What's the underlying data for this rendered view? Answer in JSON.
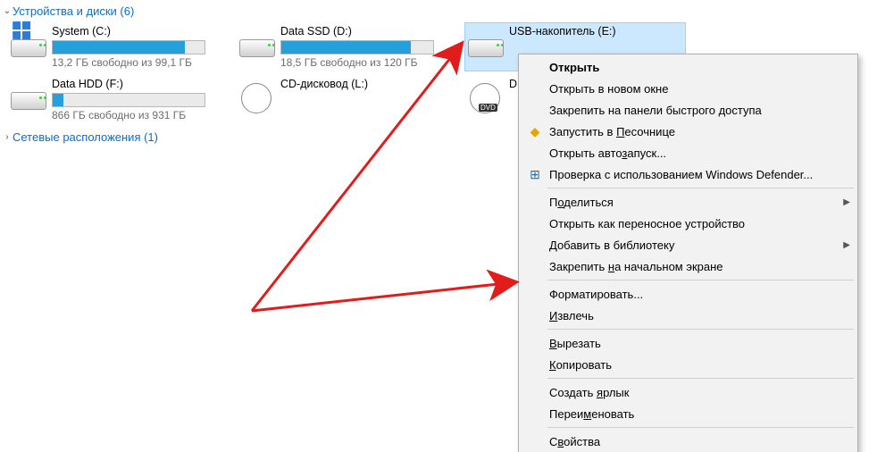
{
  "sections": {
    "drives": {
      "title": "Устройства и диски (6)",
      "expanded": true
    },
    "network": {
      "title": "Сетевые расположения (1)",
      "expanded": false
    }
  },
  "drives": [
    {
      "name": "System (C:)",
      "sub": "13,2 ГБ свободно из 99,1 ГБ",
      "fill": 0.87,
      "kind": "sys",
      "selected": false,
      "has_bar": true
    },
    {
      "name": "Data SSD (D:)",
      "sub": "18,5 ГБ свободно из 120 ГБ",
      "fill": 0.85,
      "kind": "hdd",
      "selected": false,
      "has_bar": true
    },
    {
      "name": "USB-накопитель (E:)",
      "sub": "",
      "fill": 0,
      "kind": "hdd",
      "selected": true,
      "has_bar": false
    },
    {
      "name": "Data HDD (F:)",
      "sub": "866 ГБ свободно из 931 ГБ",
      "fill": 0.07,
      "kind": "hdd",
      "selected": false,
      "has_bar": true
    },
    {
      "name": "CD-дисковод (L:)",
      "sub": "",
      "fill": 0,
      "kind": "dvd",
      "selected": false,
      "has_bar": false
    },
    {
      "name": "D",
      "sub": "",
      "fill": 0,
      "kind": "dvd2",
      "selected": false,
      "has_bar": false
    }
  ],
  "context_menu": [
    {
      "type": "item",
      "label": "Открыть",
      "bold": true,
      "mnemonic": ""
    },
    {
      "type": "item",
      "label": "Открыть в новом окне",
      "mnemonic": ""
    },
    {
      "type": "item",
      "label": "Закрепить на панели быстрого доступа",
      "mnemonic": ""
    },
    {
      "type": "item",
      "label": "Запустить в Песочнице",
      "icon": "sandbox",
      "mnemonic": "П"
    },
    {
      "type": "item",
      "label": "Открыть автозапуск...",
      "mnemonic": "з"
    },
    {
      "type": "item",
      "label": "Проверка с использованием Windows Defender...",
      "icon": "defender",
      "mnemonic": ""
    },
    {
      "type": "sep"
    },
    {
      "type": "item",
      "label": "Поделиться",
      "submenu": true,
      "mnemonic": "о"
    },
    {
      "type": "item",
      "label": "Открыть как переносное устройство",
      "mnemonic": ""
    },
    {
      "type": "item",
      "label": "Добавить в библиотеку",
      "submenu": true,
      "mnemonic": "Д"
    },
    {
      "type": "item",
      "label": "Закрепить на начальном экране",
      "mnemonic": "н"
    },
    {
      "type": "sep"
    },
    {
      "type": "item",
      "label": "Форматировать...",
      "mnemonic": ""
    },
    {
      "type": "item",
      "label": "Извлечь",
      "mnemonic": "И"
    },
    {
      "type": "sep"
    },
    {
      "type": "item",
      "label": "Вырезать",
      "mnemonic": "В"
    },
    {
      "type": "item",
      "label": "Копировать",
      "mnemonic": "К"
    },
    {
      "type": "sep"
    },
    {
      "type": "item",
      "label": "Создать ярлык",
      "mnemonic": "я"
    },
    {
      "type": "item",
      "label": "Переименовать",
      "mnemonic": "м"
    },
    {
      "type": "sep"
    },
    {
      "type": "item",
      "label": "Свойства",
      "mnemonic": "в"
    }
  ],
  "colors": {
    "accent": "#26a0da",
    "link": "#0a6dcd",
    "arrow": "#e21b1b"
  }
}
